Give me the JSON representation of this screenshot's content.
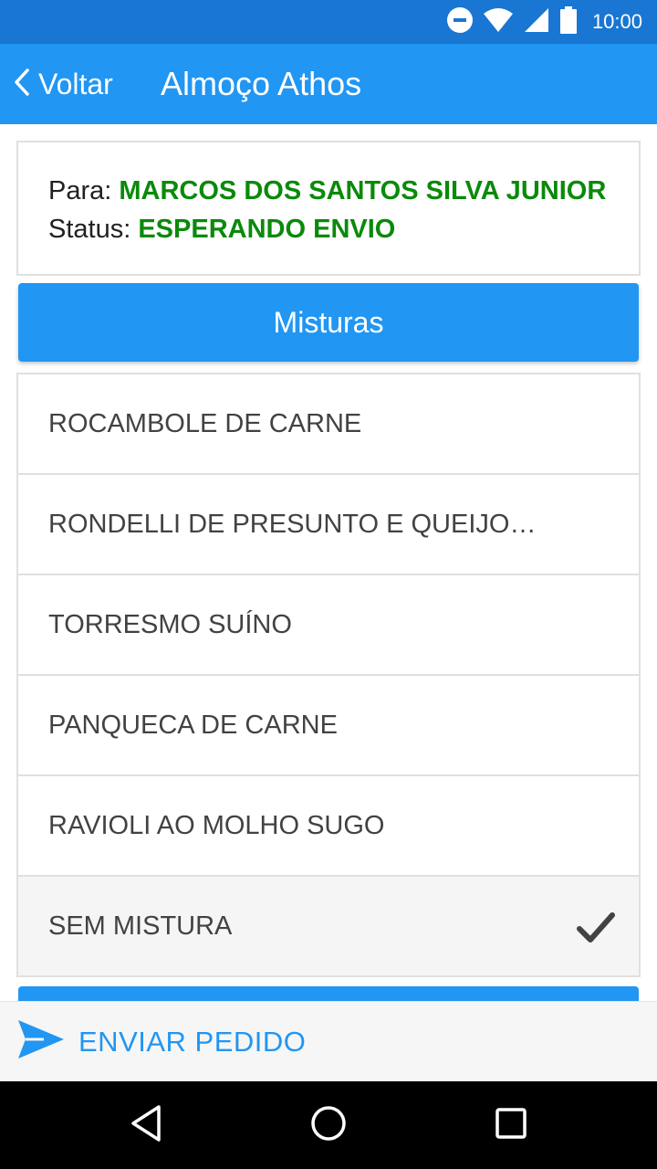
{
  "status_bar": {
    "time": "10:00",
    "icons": [
      "do-not-disturb-icon",
      "wifi-icon",
      "signal-icon",
      "battery-icon"
    ]
  },
  "app_bar": {
    "back_label": "Voltar",
    "title": "Almoço Athos"
  },
  "info": {
    "to_label": "Para:",
    "to_value": "MARCOS DOS SANTOS SILVA JUNIOR",
    "status_label": "Status:",
    "status_value": "ESPERANDO ENVIO"
  },
  "section": {
    "title": "Misturas"
  },
  "items": [
    {
      "label": "ROCAMBOLE DE CARNE",
      "selected": false
    },
    {
      "label": "RONDELLI DE PRESUNTO E QUEIJO AO MOLHO BRANCO",
      "selected": false
    },
    {
      "label": "TORRESMO SUÍNO",
      "selected": false
    },
    {
      "label": "PANQUECA DE CARNE",
      "selected": false
    },
    {
      "label": "RAVIOLI AO MOLHO SUGO",
      "selected": false
    },
    {
      "label": "SEM MISTURA",
      "selected": true
    }
  ],
  "bottom_action": {
    "label": "ENVIAR PEDIDO",
    "icon": "send-icon"
  },
  "nav": {
    "icons": [
      "back-triangle-icon",
      "home-circle-icon",
      "recents-square-icon"
    ]
  },
  "colors": {
    "primary": "#2196f3",
    "primary_dark": "#1976d2",
    "success_text": "#0a8a0a"
  }
}
